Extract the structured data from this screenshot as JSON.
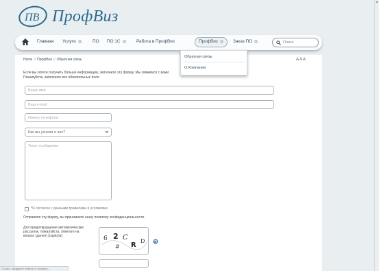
{
  "brand": {
    "name": "ПрофВиз",
    "monogram": "ПВ",
    "color": "#2a6a8f"
  },
  "nav": {
    "items": [
      {
        "label": "Главная",
        "dropdown": false
      },
      {
        "label": "Услуги",
        "dropdown": true
      },
      {
        "label": "ПО",
        "dropdown": false
      },
      {
        "label": "ПО 1С",
        "dropdown": true
      },
      {
        "label": "Работа в ПрофВиз",
        "dropdown": false
      },
      {
        "label": "ПрофВиз",
        "dropdown": true,
        "active": true
      },
      {
        "label": "Заказ ПО",
        "dropdown": true
      }
    ],
    "search_placeholder": "Поиск"
  },
  "submenu": {
    "items": [
      "Обратная связь",
      "О Компании"
    ]
  },
  "breadcrumb": {
    "items": [
      "Home",
      "ПрофВиз",
      "Обратная связь"
    ],
    "separator": "//"
  },
  "font_size_controls": "A A A",
  "intro": {
    "line1": "Если вы хотите получить больше информации, заполните эту форму. Мы свяжемся с вами",
    "line2": "Пожалуйста, заполните все обязательные поля"
  },
  "form": {
    "name_placeholder": "Ваше имя",
    "email_placeholder": "Ваш e-mail",
    "phone_placeholder": "Номер телефона",
    "source_select": "Как вы узнали о нас?",
    "message_placeholder": "Текст сообщения",
    "consent_star": "*",
    "consent_text": "Я согласен с данными правилами и условиями",
    "policy_text": "Отправляя эту форму, вы принимаете нашу политику конфиденциальности.",
    "captcha_label": "Для предотвращения автоматических рассылок, пожалуйста, ответьте на вопрос (далее) [captcha]",
    "captcha_chars": [
      "6",
      "2",
      "C",
      "#",
      "R",
      "D"
    ]
  },
  "statusbar": "Готово: ожидание ответа от сервера…"
}
